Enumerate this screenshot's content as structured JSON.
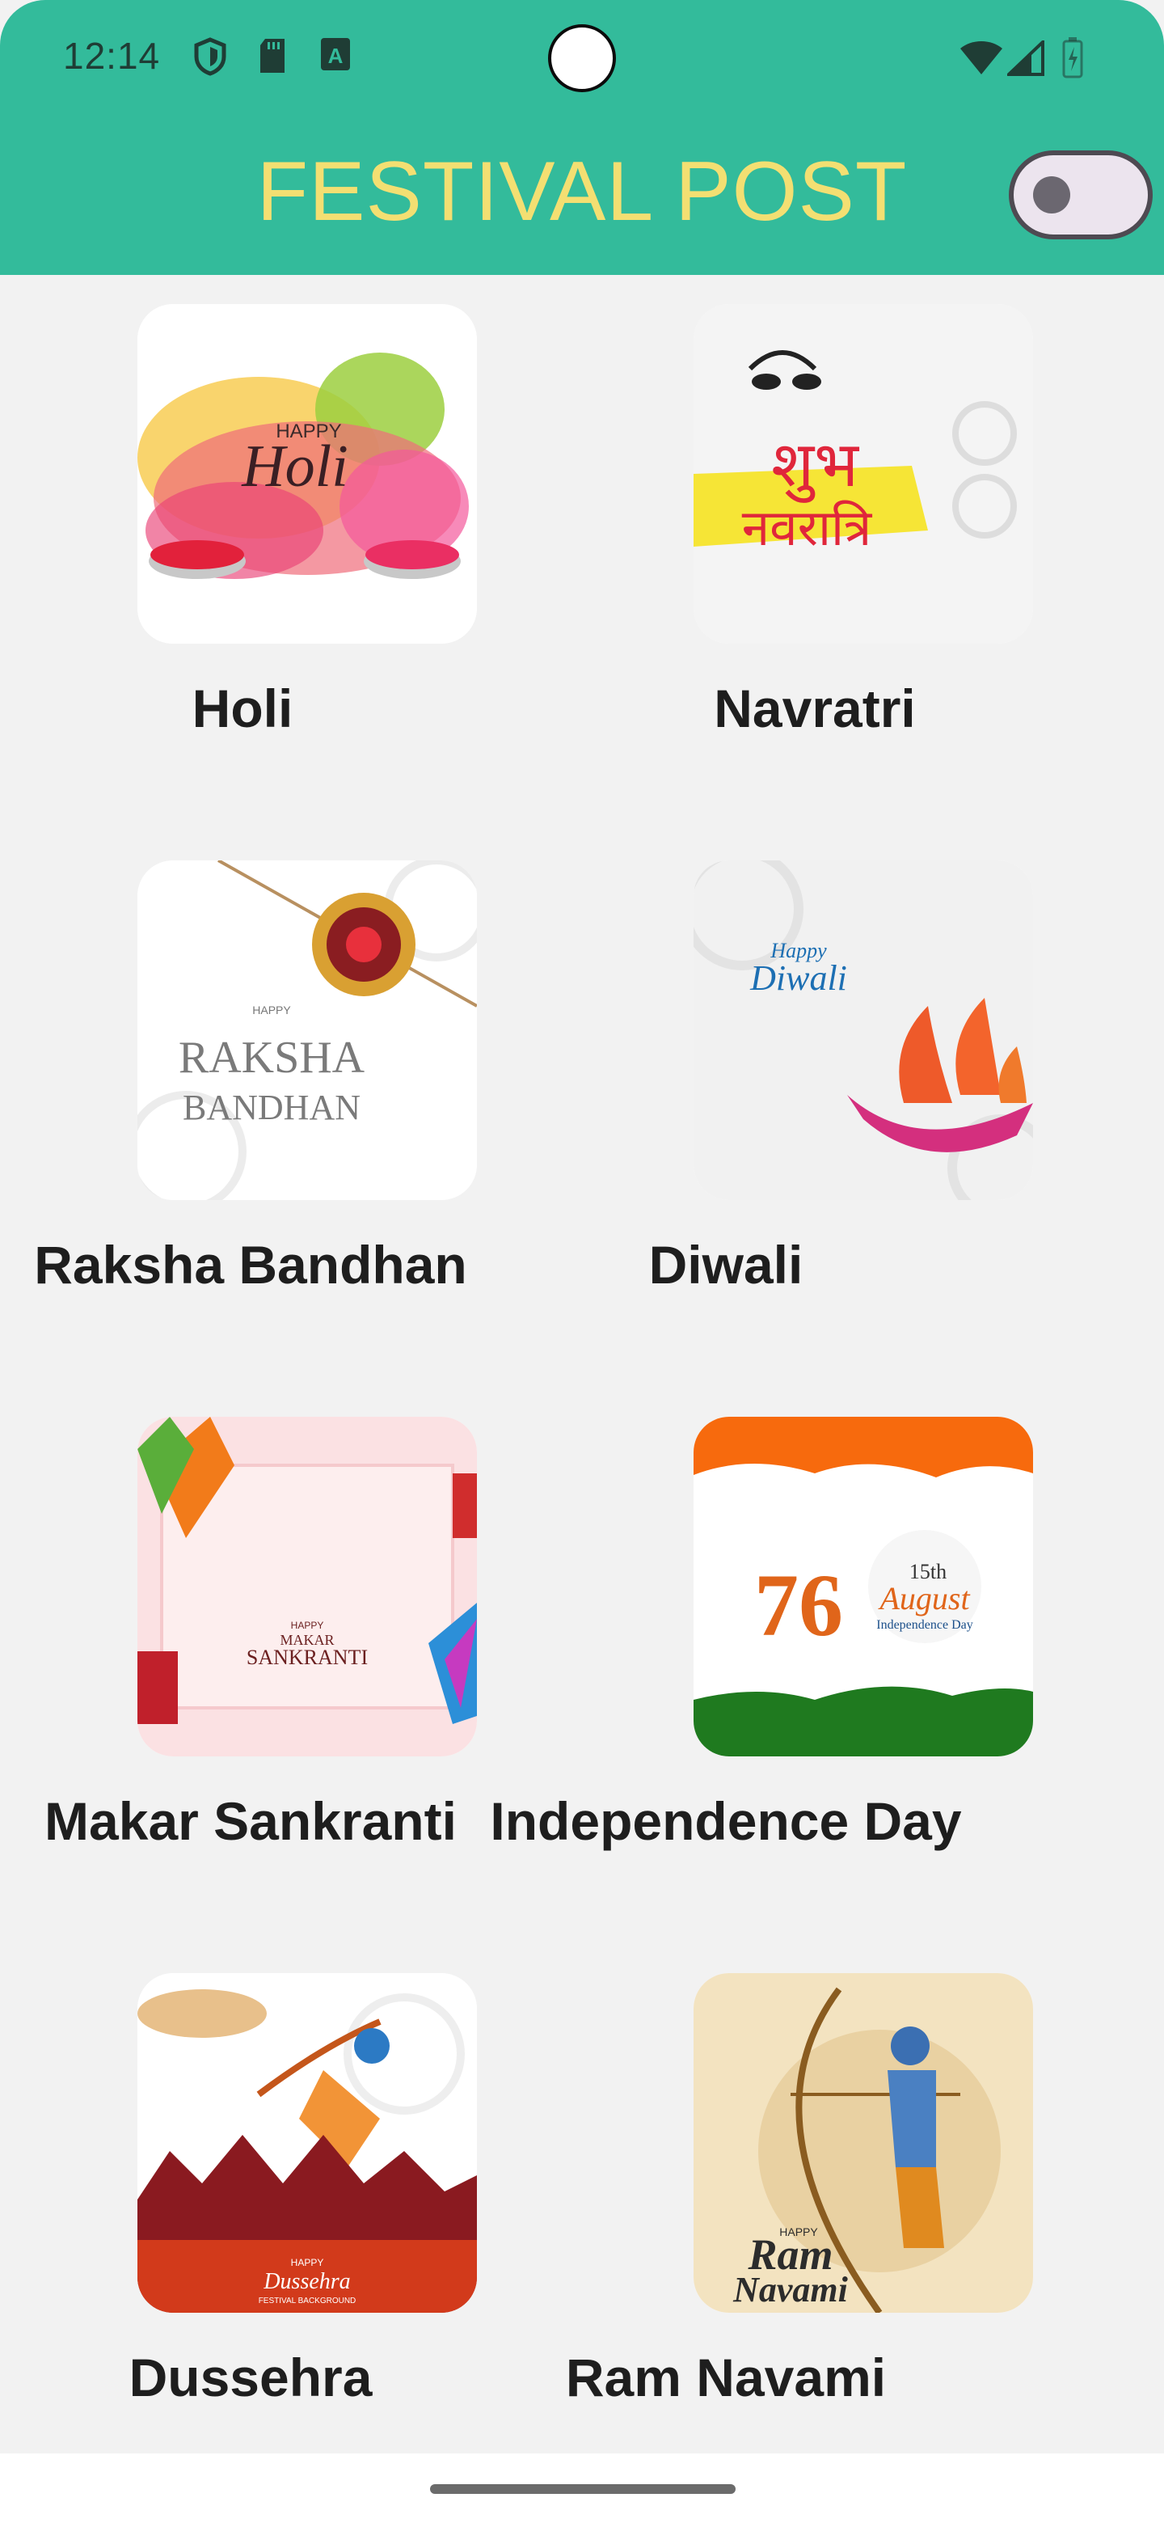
{
  "status_bar": {
    "time": "12:14",
    "icons": [
      "shield-icon",
      "sd-card-icon",
      "font-a-icon",
      "wifi-icon",
      "signal-icon",
      "battery-icon"
    ]
  },
  "app_bar": {
    "title": "FESTIVAL POST",
    "title_color": "#f3df72",
    "background": "#33bb9b",
    "theme_toggle": {
      "state": "off"
    }
  },
  "festivals": [
    {
      "label": "Holi",
      "image": "holi-image"
    },
    {
      "label": "Navratri",
      "image": "navratri-image"
    },
    {
      "label": "Raksha Bandhan",
      "image": "raksha-bandhan-image"
    },
    {
      "label": "Diwali",
      "image": "diwali-image"
    },
    {
      "label": "Makar Sankranti",
      "image": "makar-sankranti-image"
    },
    {
      "label": "Independence Day",
      "image": "independence-day-image"
    },
    {
      "label": "Dussehra",
      "image": "dussehra-image"
    },
    {
      "label": "Ram Navami",
      "image": "ram-navami-image"
    }
  ],
  "images": {
    "holi": {
      "line1": "HAPPY",
      "line2": "Holi"
    },
    "navratri": {
      "line1": "शुभ",
      "line2": "नवरात्रि"
    },
    "raksha": {
      "line1": "HAPPY",
      "line2": "RAKSHA",
      "line3": "BANDHAN"
    },
    "diwali": {
      "line1": "Happy",
      "line2": "Diwali"
    },
    "makar": {
      "line1": "HAPPY",
      "line2": "MAKAR",
      "line3": "SANKRANTI"
    },
    "independence": {
      "number": "76",
      "date": "15th",
      "line1": "August",
      "line2": "Independence Day"
    },
    "dussehra": {
      "line1": "HAPPY",
      "line2": "Dussehra",
      "line3": "FESTIVAL BACKGROUND"
    },
    "ramnavami": {
      "line1": "HAPPY",
      "line2": "Ram",
      "line3": "Navami"
    }
  }
}
